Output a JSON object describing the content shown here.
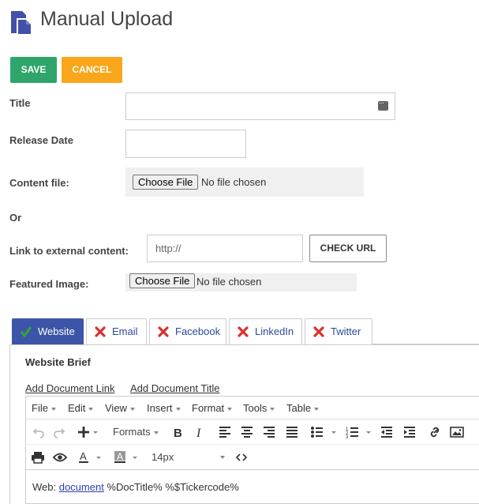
{
  "header": {
    "title": "Manual Upload"
  },
  "actions": {
    "save_label": "SAVE",
    "cancel_label": "CANCEL"
  },
  "form": {
    "title_label": "Title",
    "release_date_label": "Release Date",
    "content_file_label": "Content file:",
    "or_label": "Or",
    "link_label": "Link to external content:",
    "link_placeholder": "http://",
    "check_url_label": "CHECK URL",
    "featured_image_label": "Featured Image:",
    "choose_file_label": "Choose File",
    "no_file_label": "No file chosen"
  },
  "tabs": [
    {
      "label": "Website",
      "status": "check"
    },
    {
      "label": "Email",
      "status": "x"
    },
    {
      "label": "Facebook",
      "status": "x"
    },
    {
      "label": "LinkedIn",
      "status": "x"
    },
    {
      "label": "Twitter",
      "status": "x"
    }
  ],
  "panel": {
    "brief_title": "Website Brief",
    "add_doc_link": "Add Document Link",
    "add_doc_title": "Add Document Title"
  },
  "editor": {
    "menus": [
      "File",
      "Edit",
      "View",
      "Insert",
      "Format",
      "Tools",
      "Table"
    ],
    "formats_label": "Formats",
    "font_size": "14px",
    "content_prefix": "Web: ",
    "content_link": "document",
    "content_suffix": " %DocTitle% %$Tickercode%"
  },
  "colors": {
    "save": "#2fa56b",
    "cancel": "#f9a61a",
    "active_tab": "#3d55a8",
    "icon_blue": "#4250a8",
    "x_red": "#d9322e",
    "check_green": "#3aa03a"
  }
}
